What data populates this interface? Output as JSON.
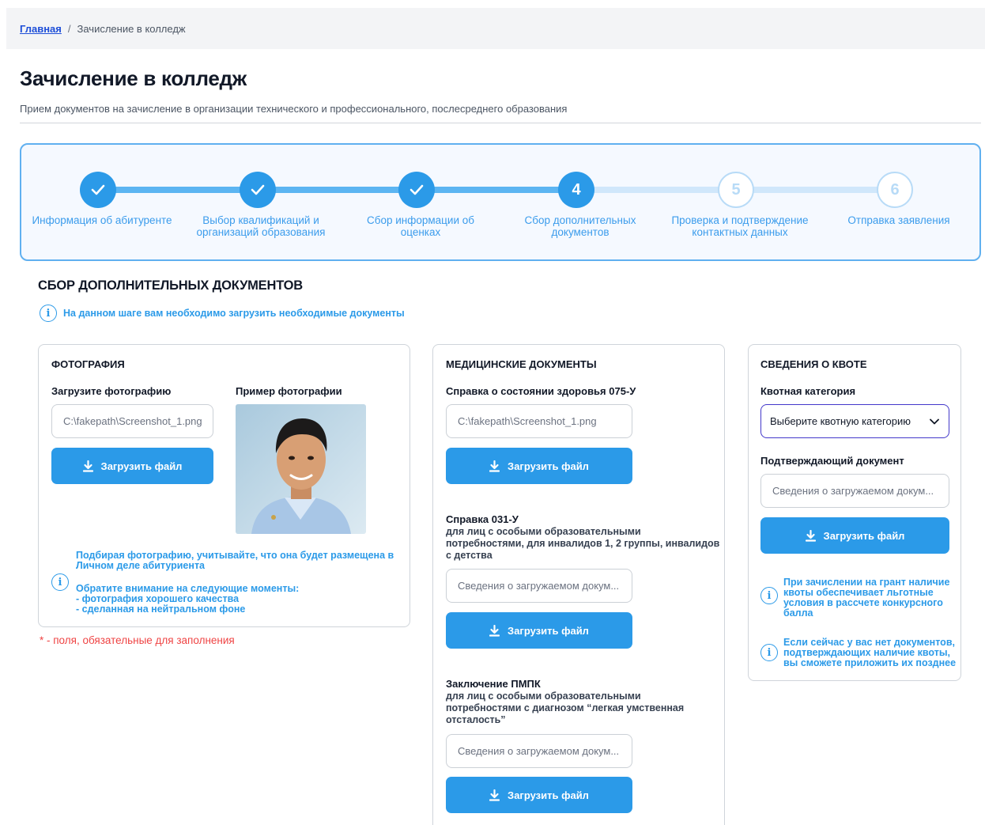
{
  "breadcrumb": {
    "home": "Главная",
    "separator": "/",
    "current": "Зачисление в колледж"
  },
  "page": {
    "title": "Зачисление в колледж",
    "subtitle": "Прием документов на зачисление в организации технического и профессионального, послесреднего образования"
  },
  "stepper": {
    "steps": [
      {
        "number": "1",
        "label": "Информация об абитуренте",
        "state": "done"
      },
      {
        "number": "2",
        "label": "Выбор квалификаций и организаций образования",
        "state": "done"
      },
      {
        "number": "3",
        "label": "Сбор информации об оценках",
        "state": "done"
      },
      {
        "number": "4",
        "label": "Сбор дополнительных документов",
        "state": "current"
      },
      {
        "number": "5",
        "label": "Проверка и подтверждение контактных данных",
        "state": "todo"
      },
      {
        "number": "6",
        "label": "Отправка заявления",
        "state": "todo"
      }
    ]
  },
  "section": {
    "title": "СБОР ДОПОЛНИТЕЛЬНЫХ ДОКУМЕНТОВ",
    "info": "На данном шаге вам необходимо загрузить необходимые документы"
  },
  "photo_card": {
    "title": "ФОТОГРАФИЯ",
    "upload_label": "Загрузите фотографию",
    "example_label": "Пример фотографии",
    "file_value": "C:\\fakepath\\Screenshot_1.png",
    "button": "Загрузить файл",
    "note_line1": "Подбирая фотографию, учитывайте, что она будет размещена в",
    "note_line2": "Личном деле абитуриента",
    "attention_title": "Обратите внимание на следующие моменты:",
    "attention_item1": "- фотография хорошего качества",
    "attention_item2": "- сделанная на нейтральном фоне"
  },
  "required_note": "* - поля, обязательные для заполнения",
  "medical_card": {
    "title": "МЕДИЦИНСКИЕ ДОКУМЕНТЫ",
    "doc1_label": "Справка о состоянии здоровья 075-У",
    "doc1_value": "C:\\fakepath\\Screenshot_1.png",
    "doc2_label": "Справка 031-У",
    "doc2_sub_line1": "для лиц с особыми образовательными",
    "doc2_sub_line2": "потребностями, для инвалидов 1, 2 группы, инвалидов",
    "doc2_sub_line3": "с детства",
    "doc2_placeholder": "Сведения о загружаемом докум...",
    "doc3_label": "Заключение ПМПК",
    "doc3_sub_line1": "для лиц с особыми образовательными",
    "doc3_sub_line2": "потребностями с диагнозом “легкая умственная",
    "doc3_sub_line3": "отсталость”",
    "doc3_placeholder": "Сведения о загружаемом докум...",
    "button": "Загрузить файл"
  },
  "quota_card": {
    "title": "СВЕДЕНИЯ О КВОТЕ",
    "category_label": "Квотная категория",
    "category_select": "Выберите квотную категорию",
    "doc_label": "Подтверждающий документ",
    "doc_placeholder": "Сведения о загружаемом докум...",
    "button": "Загрузить файл",
    "note1_line1": "При зачислении на грант наличие",
    "note1_line2": "квоты обеспечивает льготные",
    "note1_line3": "условия в рассчете конкурсного",
    "note1_line4": "балла",
    "note2_line1": "Если сейчас у вас нет документов,",
    "note2_line2": "подтверждающих наличие квоты,",
    "note2_line3": "вы сможете приложить их позднее"
  },
  "colors": {
    "accent": "#2b9ae8",
    "required": "#ef4444",
    "select_border": "#4338ca"
  }
}
